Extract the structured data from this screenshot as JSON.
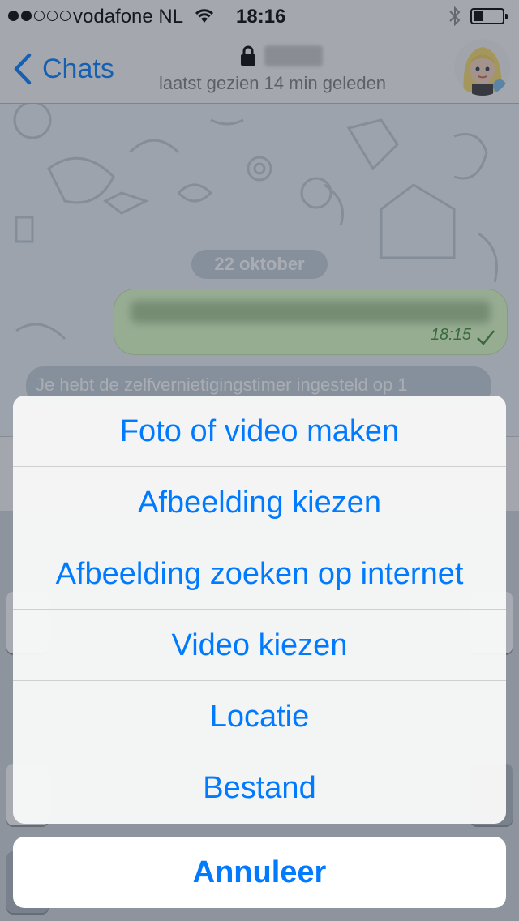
{
  "status_bar": {
    "carrier": "vodafone NL",
    "time": "18:16",
    "signal_bars_filled": 2,
    "signal_bars_total": 5,
    "battery_level": 0.25
  },
  "nav": {
    "back_label": "Chats",
    "subtitle": "laatst gezien 14 min geleden"
  },
  "chat": {
    "date_label": "22 oktober",
    "outgoing_message": {
      "time": "18:15"
    },
    "service_message": "Je hebt de zelfvernietigingstimer ingesteld op 1"
  },
  "action_sheet": {
    "items": [
      {
        "label": "Foto of video maken"
      },
      {
        "label": "Afbeelding kiezen"
      },
      {
        "label": "Afbeelding zoeken op internet"
      },
      {
        "label": "Video kiezen"
      },
      {
        "label": "Locatie"
      },
      {
        "label": "Bestand"
      }
    ],
    "cancel_label": "Annuleer"
  },
  "colors": {
    "accent": "#007aff",
    "outgoing_bubble": "#e1ffc7",
    "read_check": "#3e8a34"
  },
  "icons": [
    "wifi-icon",
    "bluetooth-icon",
    "battery-icon",
    "back-chevron-icon",
    "lock-icon",
    "checkmark-icon",
    "avatar"
  ]
}
